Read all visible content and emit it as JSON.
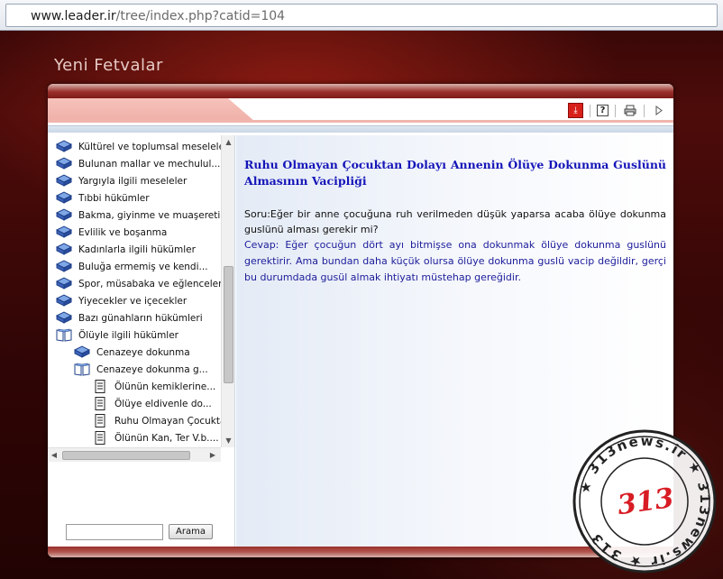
{
  "browser": {
    "url_host": "www.leader.ir",
    "url_path": "/tree/index.php?catid=104"
  },
  "site": {
    "title": "Yeni Fetvalar"
  },
  "toolbar": {
    "icons": [
      "download-icon",
      "help-icon",
      "print-icon",
      "next-arrow-icon"
    ]
  },
  "tree": {
    "items": [
      {
        "label": "Kültürel ve toplumsal meseleler",
        "icon": "closed-book-icon",
        "level": 0
      },
      {
        "label": "Bulunan mallar ve mechulul...",
        "icon": "closed-book-icon",
        "level": 0
      },
      {
        "label": "Yargıyla ilgili meseleler",
        "icon": "closed-book-icon",
        "level": 0
      },
      {
        "label": "Tıbbi hükümler",
        "icon": "closed-book-icon",
        "level": 0
      },
      {
        "label": "Bakma, giyinme ve muaşeretin...",
        "icon": "closed-book-icon",
        "level": 0
      },
      {
        "label": "Evlilik ve boşanma",
        "icon": "closed-book-icon",
        "level": 0
      },
      {
        "label": "Kadınlarla ilgili hükümler",
        "icon": "closed-book-icon",
        "level": 0
      },
      {
        "label": "Buluğa ermemiş ve kendi...",
        "icon": "closed-book-icon",
        "level": 0
      },
      {
        "label": "Spor, müsabaka ve eğlenceler",
        "icon": "closed-book-icon",
        "level": 0
      },
      {
        "label": "Yiyecekler ve içecekler",
        "icon": "closed-book-icon",
        "level": 0
      },
      {
        "label": "Bazı günahların hükümleri",
        "icon": "closed-book-icon",
        "level": 0
      },
      {
        "label": "Ölüyle ilgili hükümler",
        "icon": "open-book-icon",
        "level": 0
      },
      {
        "label": "Cenazeye dokunma",
        "icon": "closed-book-icon",
        "level": 1
      },
      {
        "label": "Cenazeye dokunma g...",
        "icon": "open-book-icon",
        "level": 1
      },
      {
        "label": "Ölünün kemiklerine...",
        "icon": "document-icon",
        "level": 2
      },
      {
        "label": "Ölüye eldivenle do...",
        "icon": "document-icon",
        "level": 2
      },
      {
        "label": "Ruhu Olmayan Çocuktan",
        "icon": "document-icon",
        "level": 2
      },
      {
        "label": "Ölünün Kan, Ter V.b....",
        "icon": "document-icon",
        "level": 2
      }
    ]
  },
  "search": {
    "value": "",
    "button_label": "Arama"
  },
  "article": {
    "title": "Ruhu Olmayan Çocuktan Dolayı Annenin Ölüye Dokunma Guslünü Almasının Vacipliği",
    "question": "Soru:Eğer bir anne çocuğuna ruh verilmeden düşük yaparsa acaba ölüye dokunma guslünü alması gerekir mi?",
    "answer": "Cevap: Eğer çocuğun dört ayı bitmişse ona dokunmak ölüye dokunma guslünü gerektirir. Ama bundan daha küçük olursa ölüye dokunma guslü vacip değildir, gerçi bu durumdada gusül almak  ihtiyatı müstehap gereğidir."
  },
  "watermark": {
    "site": "313news.ir",
    "number": "313"
  },
  "colors": {
    "title_blue": "#1515b8",
    "answer_blue": "#1c1c9a",
    "frame_red": "#9a2f2a",
    "accent_pink": "#f0b6ae"
  }
}
